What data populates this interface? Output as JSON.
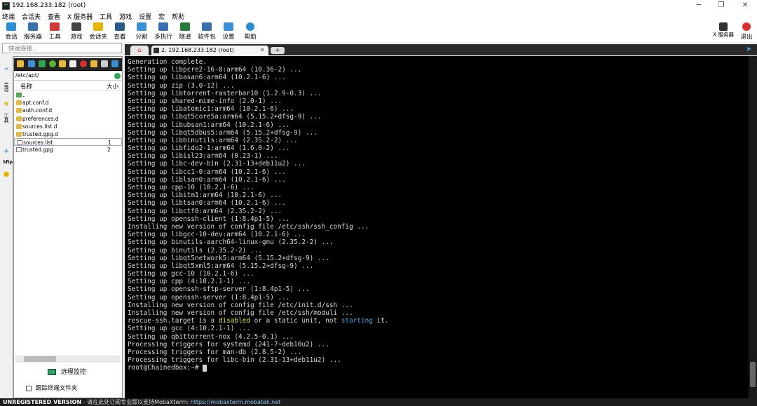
{
  "window": {
    "title": "192.168.233.182 (root)",
    "controls": [
      "─",
      "❐",
      "✕"
    ]
  },
  "menu": [
    "终端",
    "会话夹",
    "查看",
    "X 服务器",
    "工具",
    "游戏",
    "设置",
    "宏",
    "帮助"
  ],
  "toolbar": {
    "items": [
      {
        "label": "会话",
        "icon": "session-icon",
        "color": "#2a8fd6"
      },
      {
        "label": "服务器",
        "icon": "servers-icon",
        "color": "#3a6fb0"
      },
      {
        "label": "工具",
        "icon": "tools-icon",
        "color": "#d23a3a"
      },
      {
        "label": "游戏",
        "icon": "games-icon",
        "color": "#444444"
      },
      {
        "label": "会话夹",
        "icon": "star-icon",
        "color": "#e8b400"
      },
      {
        "label": "查看",
        "icon": "view-icon",
        "color": "#2a5c8a"
      },
      {
        "label": "分割",
        "icon": "split-icon",
        "color": "#3a8fd6"
      },
      {
        "label": "多执行",
        "icon": "multiexec-icon",
        "color": "#3a6fb0"
      },
      {
        "label": "隧道",
        "icon": "tunneling-icon",
        "color": "#2a7a3a"
      },
      {
        "label": "软件包",
        "icon": "packages-icon",
        "color": "#3a6fb0"
      },
      {
        "label": "设置",
        "icon": "settings-icon",
        "color": "#3a8fd6"
      },
      {
        "label": "帮助",
        "icon": "help-icon",
        "color": "#2a8fd6"
      }
    ],
    "xserver_label": "X 服务器",
    "exit_label": "退出"
  },
  "quick_connect": {
    "placeholder": "快速连接..."
  },
  "tabs": {
    "home_label": "⌂",
    "session_label": "2. 192.168.233.182 (root)",
    "close_label": "✕",
    "new_tab_label": "+"
  },
  "sidebar_strip": {
    "items": [
      "会话",
      "★",
      "工具",
      "✈",
      "Sftp",
      "●"
    ]
  },
  "sftp": {
    "path": "/etc/apt/",
    "columns": {
      "name": "名称",
      "size": "大小"
    },
    "files": [
      {
        "name": "..",
        "size": "",
        "kind": "up"
      },
      {
        "name": "apt.conf.d",
        "size": "",
        "kind": "folder"
      },
      {
        "name": "auth.conf.d",
        "size": "",
        "kind": "folder"
      },
      {
        "name": "preferences.d",
        "size": "",
        "kind": "folder"
      },
      {
        "name": "sources.list.d",
        "size": "",
        "kind": "folder"
      },
      {
        "name": "trusted.gpg.d",
        "size": "",
        "kind": "folder"
      },
      {
        "name": "sources.list",
        "size": "1",
        "kind": "file",
        "selected": true
      },
      {
        "name": "trusted.gpg",
        "size": "2",
        "kind": "file"
      }
    ],
    "remote_monitor": "远程监控",
    "follow_folder": "跟踪终端文件夹"
  },
  "terminal": {
    "lines": [
      "Generation complete.",
      "Setting up libpcre2-16-0:arm64 (10.36-2) ...",
      "Setting up libasan6:arm64 (10.2.1-6) ...",
      "Setting up zip (3.0-12) ...",
      "Setting up libtorrent-rasterbar10 (1.2.9-0.3) ...",
      "Setting up shared-mime-info (2.0-1) ...",
      "Setting up libatomic1:arm64 (10.2.1-6) ...",
      "Setting up libqt5core5a:arm64 (5.15.2+dfsg-9) ...",
      "Setting up libubsan1:arm64 (10.2.1-6) ...",
      "Setting up libqt5dbus5:arm64 (5.15.2+dfsg-9) ...",
      "Setting up libbinutils:arm64 (2.35.2-2) ...",
      "Setting up libfido2-1:arm64 (1.6.0-2) ...",
      "Setting up libisl23:arm64 (0.23-1) ...",
      "Setting up libc-dev-bin (2.31-13+deb11u2) ...",
      "Setting up libcc1-0:arm64 (10.2.1-6) ...",
      "Setting up liblsan0:arm64 (10.2.1-6) ...",
      "Setting up cpp-10 (10.2.1-6) ...",
      "Setting up libitm1:arm64 (10.2.1-6) ...",
      "Setting up libtsan0:arm64 (10.2.1-6) ...",
      "Setting up libctf0:arm64 (2.35.2-2) ...",
      "Setting up openssh-client (1:8.4p1-5) ...",
      "Installing new version of config file /etc/ssh/ssh_config ...",
      "Setting up libgcc-10-dev:arm64 (10.2.1-6) ...",
      "Setting up binutils-aarch64-linux-gnu (2.35.2-2) ...",
      "Setting up binutils (2.35.2-2) ...",
      "Setting up libqt5network5:arm64 (5.15.2+dfsg-9) ...",
      "Setting up libqt5xml5:arm64 (5.15.2+dfsg-9) ...",
      "Setting up gcc-10 (10.2.1-6) ...",
      "Setting up cpp (4:10.2.1-1) ...",
      "Setting up openssh-sftp-server (1:8.4p1-5) ...",
      "Setting up openssh-server (1:8.4p1-5) ...",
      "Installing new version of config file /etc/init.d/ssh ...",
      "Installing new version of config file /etc/ssh/moduli ..."
    ],
    "rescue": {
      "pre": "rescue-ssh.target is a ",
      "disabled": "disabled",
      "mid": " or a static unit, not ",
      "starting": "starting",
      "post": " it."
    },
    "lines_after": [
      "Setting up gcc (4:10.2.1-1) ...",
      "Setting up qbittorrent-nox (4.2.5-0.1) ...",
      "Processing triggers for systemd (241-7~deb10u2) ...",
      "Processing triggers for man-db (2.8.5-2) ...",
      "Processing triggers for libc-bin (2.31-13+deb11u2) ..."
    ],
    "prompt": "root@Chainedbox:~# "
  },
  "statusbar": {
    "unregistered": "UNREGISTERED VERSION",
    "message": "  -  请在此处订阅专业版以支持MobaXterm:  ",
    "url": "https://mobaxterm.mobatek.net"
  }
}
